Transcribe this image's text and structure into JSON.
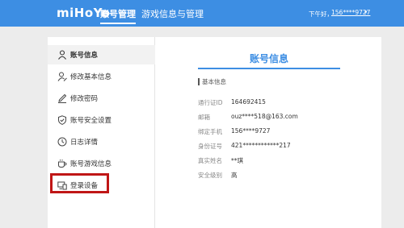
{
  "header": {
    "logo": "miHoYo",
    "tabs": [
      {
        "label": "账号管理",
        "active": true
      },
      {
        "label": "游戏信息与管理",
        "active": false
      }
    ],
    "greeting": "下午好，",
    "user": "156****9727",
    "caret": "▾"
  },
  "sidebar": {
    "items": [
      {
        "label": "账号信息",
        "icon": "user-icon",
        "active": true
      },
      {
        "label": "修改基本信息",
        "icon": "user-edit-icon",
        "active": false
      },
      {
        "label": "修改密码",
        "icon": "pencil-icon",
        "active": false
      },
      {
        "label": "账号安全设置",
        "icon": "shield-check-icon",
        "active": false
      },
      {
        "label": "日志详情",
        "icon": "clock-icon",
        "active": false
      },
      {
        "label": "账号游戏信息",
        "icon": "cup-icon",
        "active": false
      },
      {
        "label": "登录设备",
        "icon": "devices-icon",
        "active": false
      }
    ],
    "highlight_color": "#c01616"
  },
  "main": {
    "title": "账号信息",
    "section": "基本信息",
    "rows": [
      {
        "label": "通行证ID",
        "value": "164692415"
      },
      {
        "label": "邮箱",
        "value": "ouz****518@163.com"
      },
      {
        "label": "绑定手机",
        "value": "156****9727"
      },
      {
        "label": "身份证号",
        "value": "421************217"
      },
      {
        "label": "真实姓名",
        "value": "**琪"
      },
      {
        "label": "安全级别",
        "value": "高"
      }
    ]
  },
  "colors": {
    "accent": "#3d8ee3",
    "highlight": "#c01616"
  }
}
